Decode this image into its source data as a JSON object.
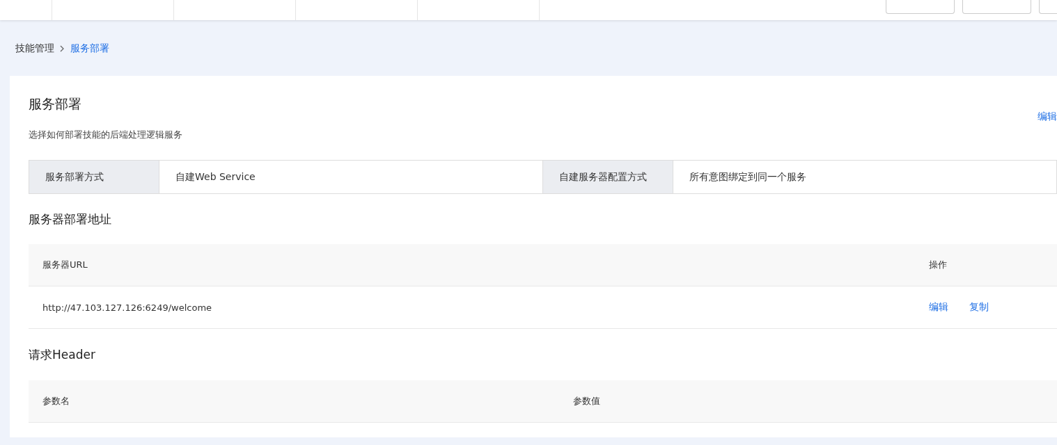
{
  "top_tabs": [
    {
      "kind": "partial"
    },
    {
      "kind": "tab"
    },
    {
      "kind": "tab"
    },
    {
      "kind": "tab"
    },
    {
      "kind": "tab"
    }
  ],
  "top_buttons": [
    {
      "kind": "button"
    },
    {
      "kind": "button"
    },
    {
      "kind": "partial"
    }
  ],
  "breadcrumb": [
    {
      "label": "技能管理",
      "current": false
    },
    {
      "label": "服务部署",
      "current": true
    }
  ],
  "page": {
    "title": "服务部署",
    "description": "选择如何部署技能的后端处理逻辑服务",
    "edit_link": "编辑"
  },
  "deployment_info": [
    {
      "label": "服务部署方式",
      "value": "自建Web Service"
    },
    {
      "label": "自建服务器配置方式",
      "value": "所有意图绑定到同一个服务"
    }
  ],
  "server_section": {
    "title": "服务器部署地址",
    "columns": [
      "服务器URL",
      "操作"
    ],
    "rows": [
      {
        "url": "http://47.103.127.126:6249/welcome",
        "actions": [
          "编辑",
          "复制"
        ]
      }
    ]
  },
  "header_section": {
    "title": "请求Header",
    "columns": [
      "参数名",
      "参数值"
    ]
  }
}
